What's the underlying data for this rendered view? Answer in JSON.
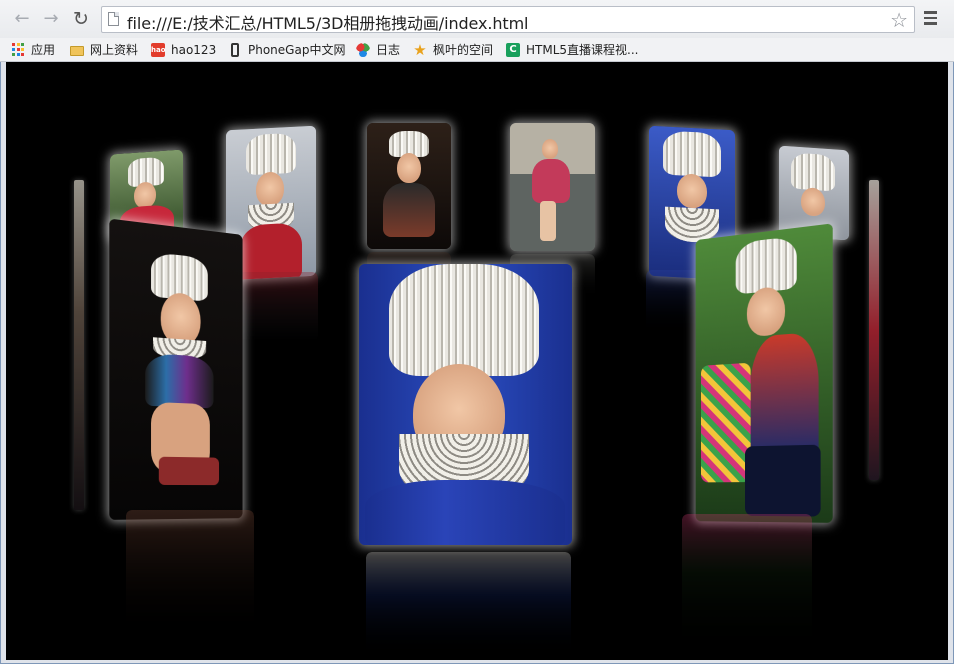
{
  "browser": {
    "url": "file:///E:/技术汇总/HTML5/3D相册拖拽动画/index.html",
    "nav": {
      "back_icon": "arrow-left-icon",
      "forward_icon": "arrow-right-icon",
      "reload_icon": "reload-icon"
    }
  },
  "bookmarks": [
    {
      "label": "应用",
      "icon": "apps-grid-icon"
    },
    {
      "label": "网上资料",
      "icon": "folder-icon"
    },
    {
      "label": "hao123",
      "icon": "hao123-icon"
    },
    {
      "label": "PhoneGap中文网",
      "icon": "phone-icon"
    },
    {
      "label": "日志",
      "icon": "flower-icon"
    },
    {
      "label": "枫叶的空间",
      "icon": "star-icon"
    },
    {
      "label": "HTML5直播课程视...",
      "icon": "c-logo-icon"
    }
  ],
  "colors": {
    "gallery_background": "#000000",
    "card_glow": "#ffffff"
  },
  "gallery": {
    "photos": [
      {
        "id": "photo-back-left-far"
      },
      {
        "id": "photo-back-left"
      },
      {
        "id": "photo-back-center-left"
      },
      {
        "id": "photo-back-center-right"
      },
      {
        "id": "photo-back-right"
      },
      {
        "id": "photo-back-right-far"
      },
      {
        "id": "photo-front-left"
      },
      {
        "id": "photo-front-center"
      },
      {
        "id": "photo-front-right"
      }
    ]
  }
}
